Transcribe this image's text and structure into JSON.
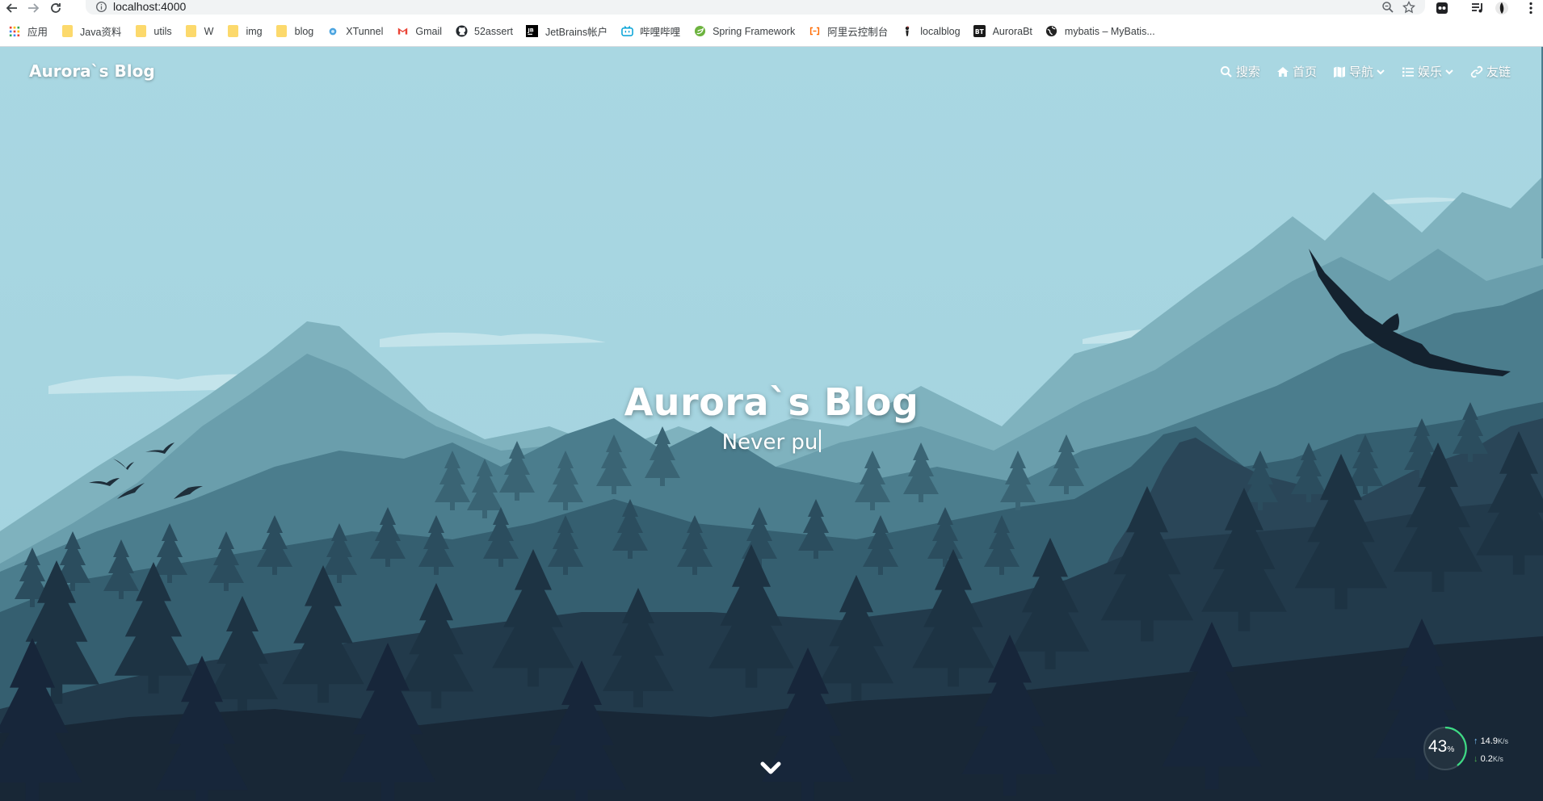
{
  "browser": {
    "url": "localhost:4000",
    "bookmarks": [
      {
        "label": "应用",
        "icon": "apps-grid-icon"
      },
      {
        "label": "Java资料",
        "icon": "folder-icon"
      },
      {
        "label": "utils",
        "icon": "folder-icon"
      },
      {
        "label": "W",
        "icon": "folder-icon"
      },
      {
        "label": "img",
        "icon": "folder-icon"
      },
      {
        "label": "blog",
        "icon": "folder-icon"
      },
      {
        "label": "XTunnel",
        "icon": "xtunnel-icon"
      },
      {
        "label": "Gmail",
        "icon": "gmail-icon"
      },
      {
        "label": "52assert",
        "icon": "github-icon"
      },
      {
        "label": "JetBrains帐户",
        "icon": "jetbrains-icon"
      },
      {
        "label": "哔哩哔哩",
        "icon": "bilibili-icon"
      },
      {
        "label": "Spring Framework",
        "icon": "spring-icon"
      },
      {
        "label": "阿里云控制台",
        "icon": "aliyun-icon"
      },
      {
        "label": "localblog",
        "icon": "localblog-icon"
      },
      {
        "label": "AuroraBt",
        "icon": "bt-icon"
      },
      {
        "label": "mybatis – MyBatis...",
        "icon": "globe-icon"
      }
    ]
  },
  "site": {
    "brand": "Aurora`s Blog",
    "nav": {
      "search": "搜索",
      "home": "首页",
      "navigation": "导航",
      "entertainment": "娱乐",
      "links": "友链"
    },
    "hero_title": "Aurora`s Blog",
    "hero_subtitle": "Never pu"
  },
  "network_monitor": {
    "percent": "43",
    "percent_unit": "%",
    "upload": "14.9",
    "download": "0.2",
    "unit": "K/s"
  },
  "colors": {
    "sky": "#a6d5e0",
    "mountain_far": "#6fa6b4",
    "mountain_mid": "#3f6d80",
    "forest_dark": "#1b2a38",
    "folder": "#fcd96c"
  }
}
